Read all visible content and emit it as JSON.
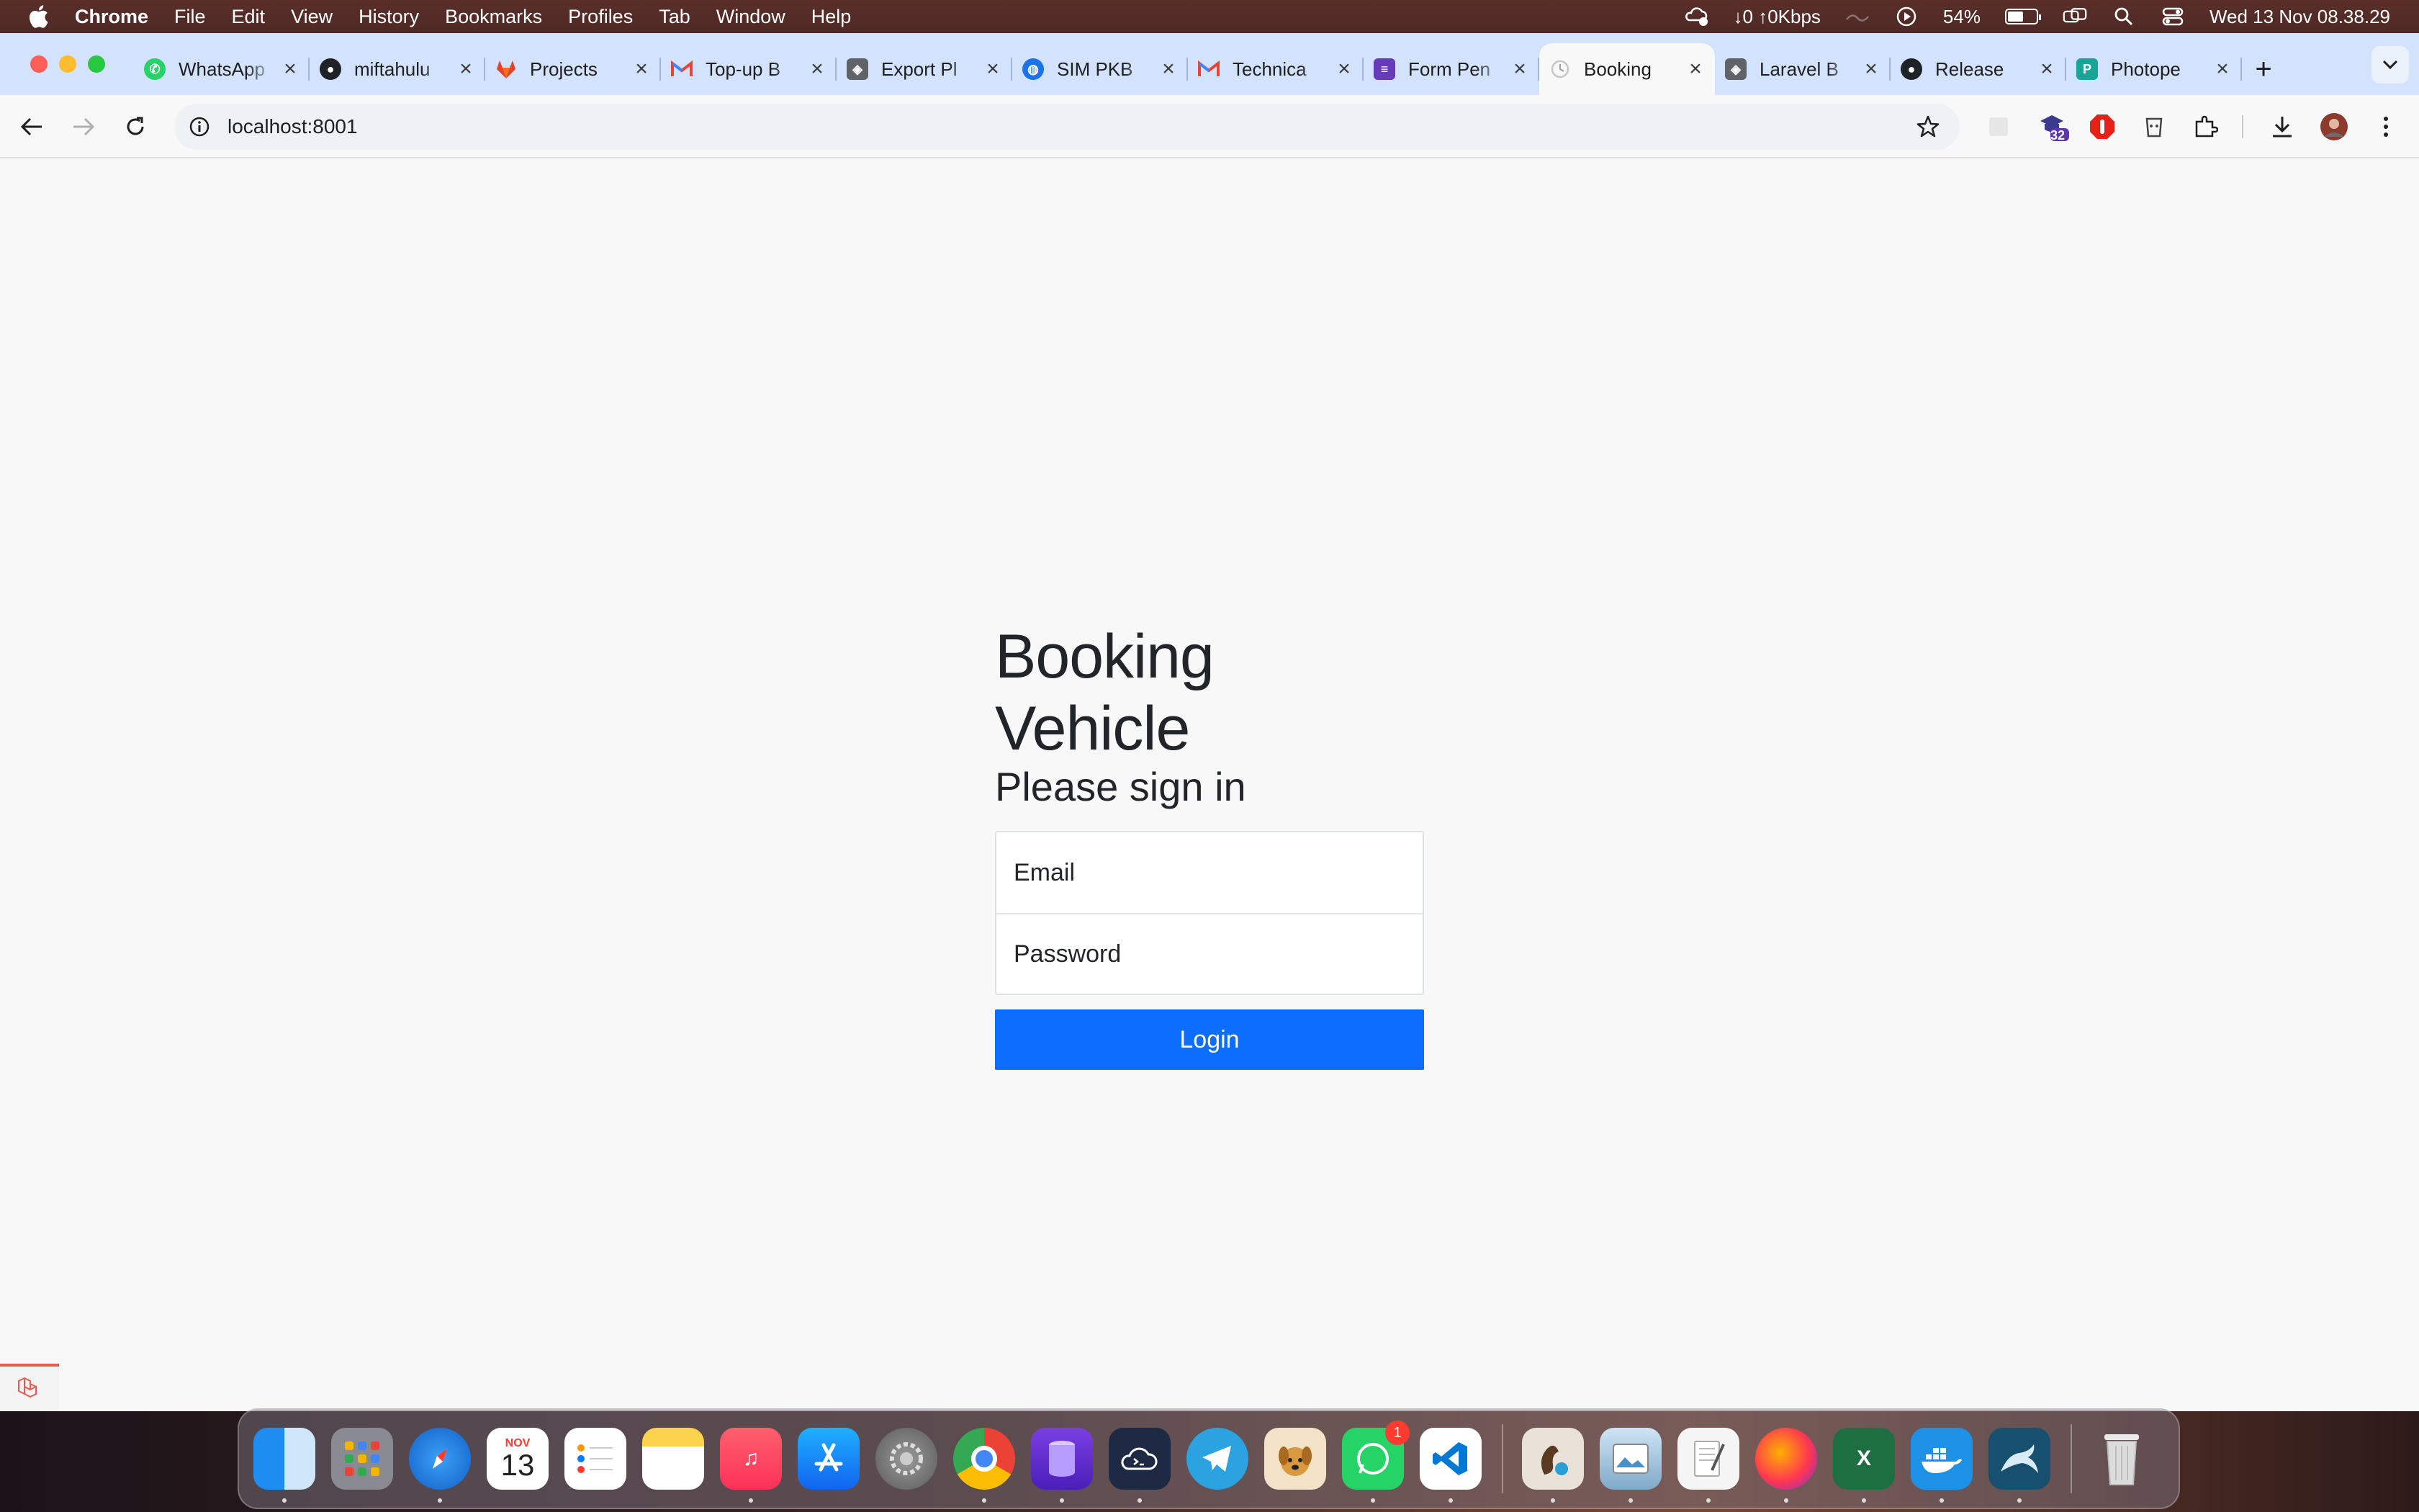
{
  "menubar": {
    "app_name": "Chrome",
    "menus": [
      "File",
      "Edit",
      "View",
      "History",
      "Bookmarks",
      "Profiles",
      "Tab",
      "Window",
      "Help"
    ],
    "network": "↓0 ↑0Kbps",
    "battery": "54%",
    "battery_level": 0.54,
    "datetime": "Wed 13 Nov  08.38.29"
  },
  "tabs": [
    {
      "title": "WhatsApp",
      "icon": "whatsapp-icon",
      "color": "#25d366"
    },
    {
      "title": "miftahulu",
      "icon": "github-icon",
      "color": "#1f2328"
    },
    {
      "title": "Projects",
      "icon": "gitlab-icon",
      "color": "#e24329"
    },
    {
      "title": "Top-up B",
      "icon": "gmail-icon",
      "color": "#ea4335"
    },
    {
      "title": "Export Pl",
      "icon": "box-icon",
      "color": "#5f6368"
    },
    {
      "title": "SIM PKB",
      "icon": "globe-icon",
      "color": "#1a73e8"
    },
    {
      "title": "Technica",
      "icon": "gmail-icon",
      "color": "#ea4335"
    },
    {
      "title": "Form Pen",
      "icon": "forms-icon",
      "color": "#673ab7"
    },
    {
      "title": "Booking",
      "icon": "loading-icon",
      "color": "#9aa0a6",
      "active": true
    },
    {
      "title": "Laravel B",
      "icon": "box-icon",
      "color": "#5f6368"
    },
    {
      "title": "Release",
      "icon": "github-icon",
      "color": "#1f2328"
    },
    {
      "title": "Photope",
      "icon": "photopea-icon",
      "color": "#18a497"
    }
  ],
  "toolbar": {
    "url": "localhost:8001",
    "extension_badge": "32"
  },
  "login": {
    "title": "Booking Vehicle",
    "subtitle": "Please sign in",
    "email_placeholder": "Email",
    "password_placeholder": "Password",
    "button_label": "Login",
    "button_color": "#0d6efd"
  },
  "dock": {
    "calendar_month": "NOV",
    "calendar_day": "13",
    "whatsapp_badge": "1"
  }
}
